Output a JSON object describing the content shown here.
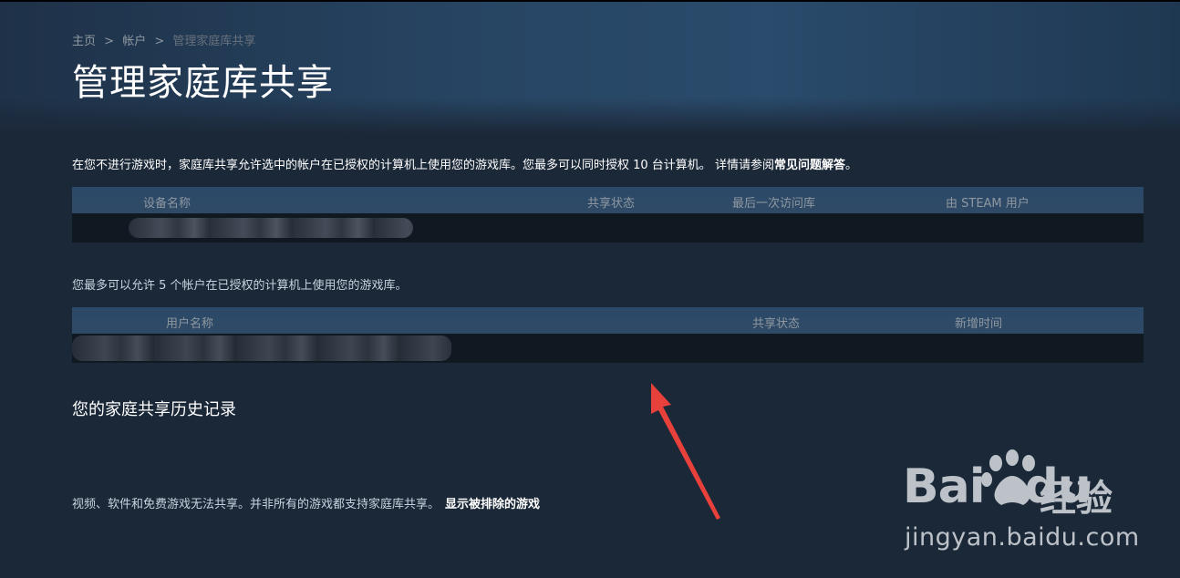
{
  "breadcrumb": {
    "home": "主页",
    "account": "帐户",
    "current": "管理家庭库共享",
    "separator": ">"
  },
  "page_title": "管理家庭库共享",
  "intro": {
    "text": "在您不进行游戏时，家庭库共享允许选中的帐户在已授权的计算机上使用您的游戏库。您最多可以同时授权 10 台计算机。 详情请参阅",
    "faq_link": "常见问题解答",
    "suffix": "。"
  },
  "devices_table": {
    "columns": {
      "device_name": "设备名称",
      "share_status": "共享状态",
      "last_access": "最后一次访问库",
      "by_user": "由 STEAM 用户"
    }
  },
  "accounts_limit_text": "您最多可以允许 5 个帐户在已授权的计算机上使用您的游戏库。",
  "accounts_table": {
    "columns": {
      "user_name": "用户名称",
      "share_status": "共享状态",
      "added_time": "新增时间"
    }
  },
  "history_heading": "您的家庭共享历史记录",
  "footer": {
    "note": "视频、软件和免费游戏无法共享。并非所有的游戏都支持家庭库共享。",
    "excluded_link": "显示被排除的游戏"
  },
  "watermark": {
    "brand_left": "Bai",
    "brand_right": "du",
    "brand_cn": "经验",
    "url": "jingyan.baidu.com"
  },
  "colors": {
    "background": "#1b2838",
    "table_header": "#2a4869",
    "table_row": "#101822",
    "arrow": "#e8403a"
  }
}
